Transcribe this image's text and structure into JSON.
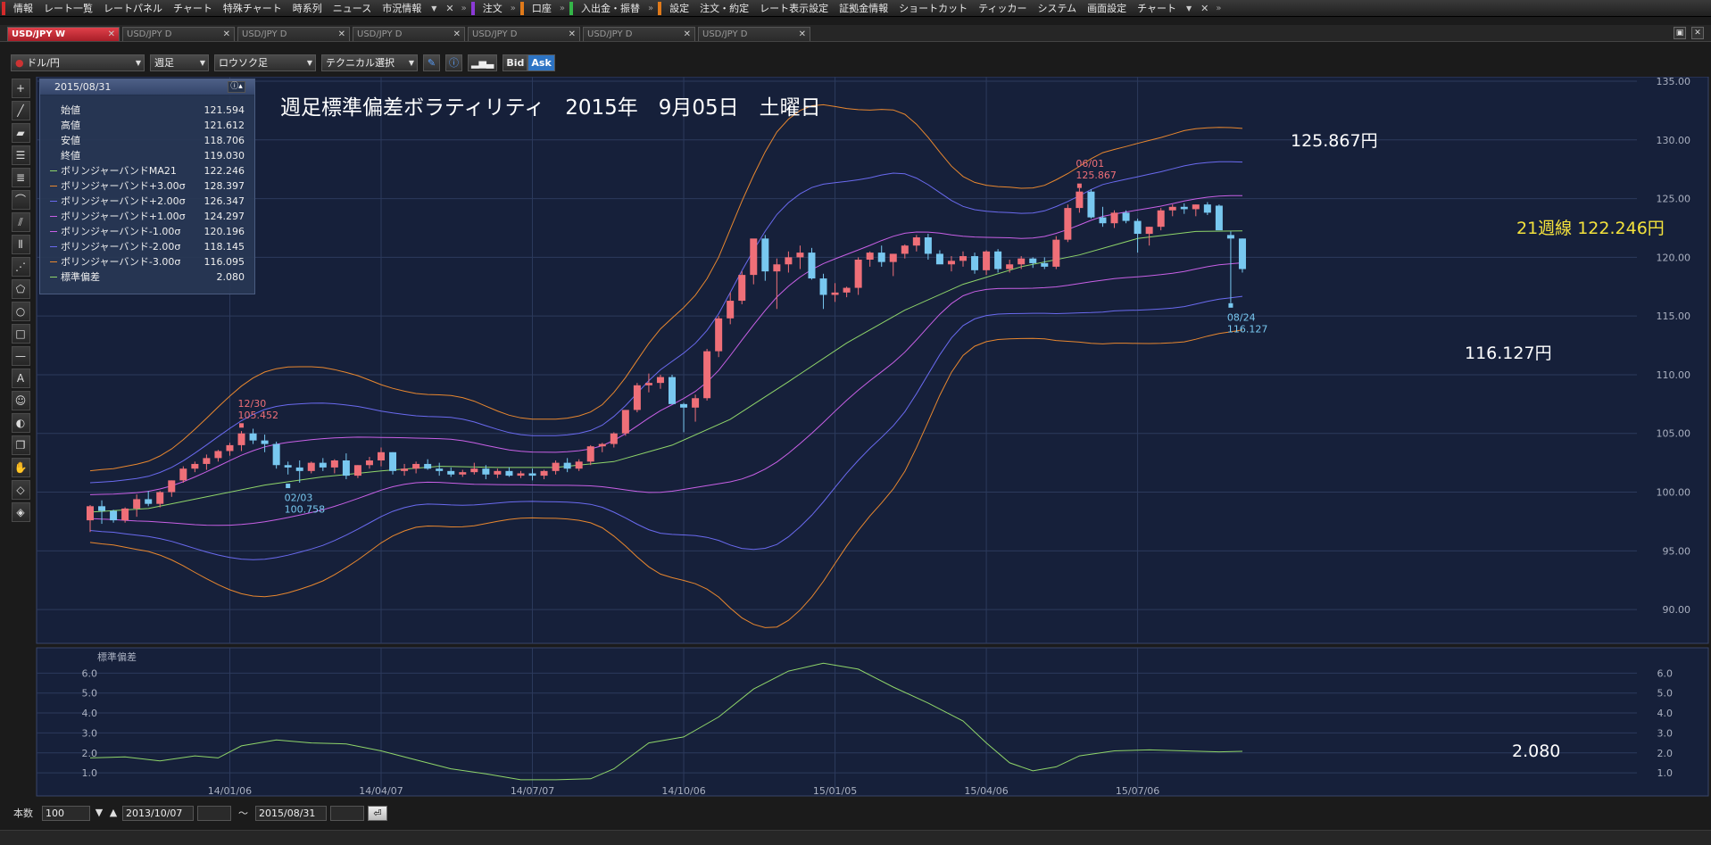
{
  "menu": {
    "groups": [
      {
        "accent": "#d32b2b",
        "items": [
          "情報",
          "レート一覧",
          "レートパネル",
          "チャート",
          "特殊チャート",
          "時系列",
          "ニュース",
          "市況情報"
        ],
        "dropdown": true,
        "close": true
      },
      {
        "accent": "#8b3ad6",
        "items": [
          "注文"
        ],
        "dropdown": false,
        "close": false
      },
      {
        "accent": "#e07a1a",
        "items": [
          "口座"
        ],
        "dropdown": false,
        "close": false
      },
      {
        "accent": "#34b548",
        "items": [
          "入出金・振替"
        ],
        "dropdown": false,
        "close": false
      },
      {
        "accent": "#e07a1a",
        "items": [
          "設定",
          "注文・約定",
          "レート表示設定",
          "証拠金情報",
          "ショートカット",
          "ティッカー",
          "システム",
          "画面設定",
          "チャート"
        ],
        "dropdown": true,
        "close": true
      }
    ]
  },
  "tabs": [
    {
      "label": "USD/JPY W",
      "active": true
    },
    {
      "label": "USD/JPY D",
      "active": false
    },
    {
      "label": "USD/JPY D",
      "active": false
    },
    {
      "label": "USD/JPY D",
      "active": false
    },
    {
      "label": "USD/JPY D",
      "active": false
    },
    {
      "label": "USD/JPY D",
      "active": false
    },
    {
      "label": "USD/JPY D",
      "active": false
    }
  ],
  "toolbar": {
    "pair": "ドル/円",
    "period": "週足",
    "chart_style": "ロウソク足",
    "technical": "テクニカル選択",
    "bid_label": "Bid",
    "ask_label": "Ask"
  },
  "info_panel": {
    "date": "2015/08/31",
    "rows": [
      {
        "label": "始値",
        "value": "121.594",
        "color": ""
      },
      {
        "label": "高値",
        "value": "121.612",
        "color": ""
      },
      {
        "label": "安値",
        "value": "118.706",
        "color": ""
      },
      {
        "label": "終値",
        "value": "119.030",
        "color": ""
      },
      {
        "label": "ボリンジャーバンドMA21",
        "value": "122.246",
        "color": "#8fd56a"
      },
      {
        "label": "ボリンジャーバンド+3.00σ",
        "value": "128.397",
        "color": "#e8872f"
      },
      {
        "label": "ボリンジャーバンド+2.00σ",
        "value": "126.347",
        "color": "#6a6aef"
      },
      {
        "label": "ボリンジャーバンド+1.00σ",
        "value": "124.297",
        "color": "#c860e6"
      },
      {
        "label": "ボリンジャーバンド-1.00σ",
        "value": "120.196",
        "color": "#c860e6"
      },
      {
        "label": "ボリンジャーバンド-2.00σ",
        "value": "118.145",
        "color": "#6a6aef"
      },
      {
        "label": "ボリンジャーバンド-3.00σ",
        "value": "116.095",
        "color": "#e8872f"
      },
      {
        "label": "標準偏差",
        "value": "2.080",
        "color": "#8fd56a"
      }
    ]
  },
  "bottom": {
    "count_label": "本数",
    "count_value": "100",
    "from_date": "2013/10/07",
    "tilde": "〜",
    "to_date": "2015/08/31"
  },
  "chart_data": [
    {
      "type": "candlestick",
      "title": "週足標準偏差ボラティリティ　2015年　9月05日　土曜日",
      "ylim": [
        87.5,
        135
      ],
      "y_ticks": [
        "90.00",
        "95.00",
        "100.00",
        "105.00",
        "110.00",
        "115.00",
        "120.00",
        "125.00",
        "130.00",
        "135.00"
      ],
      "x_ticks": [
        {
          "label": "14/01/06",
          "index": 12
        },
        {
          "label": "14/04/07",
          "index": 25
        },
        {
          "label": "14/07/07",
          "index": 38
        },
        {
          "label": "14/10/06",
          "index": 51
        },
        {
          "label": "15/01/05",
          "index": 64
        },
        {
          "label": "15/04/06",
          "index": 77
        },
        {
          "label": "15/07/06",
          "index": 90
        }
      ],
      "colors": {
        "up": "#ef6f78",
        "down": "#78c8f0",
        "ma21": "#8fd56a",
        "sigma1": "#c860e6",
        "sigma2": "#6a6aef",
        "sigma3": "#e8872f"
      },
      "candles": [
        [
          97.6,
          98.9,
          96.6,
          98.8
        ],
        [
          98.8,
          99.3,
          97.3,
          98.4
        ],
        [
          98.4,
          98.5,
          97.4,
          97.6
        ],
        [
          97.6,
          98.7,
          97.4,
          98.6
        ],
        [
          98.6,
          99.8,
          97.9,
          99.4
        ],
        [
          99.4,
          100.1,
          98.8,
          99.0
        ],
        [
          99.0,
          100.1,
          98.7,
          100.0
        ],
        [
          100.0,
          101.0,
          99.6,
          101.0
        ],
        [
          101.0,
          102.2,
          100.8,
          102.0
        ],
        [
          102.0,
          102.6,
          101.7,
          102.4
        ],
        [
          102.4,
          103.2,
          101.9,
          102.9
        ],
        [
          102.9,
          103.6,
          102.6,
          103.5
        ],
        [
          103.5,
          104.2,
          103.1,
          104.0
        ],
        [
          104.0,
          105.2,
          103.5,
          105.0
        ],
        [
          105.0,
          105.4,
          104.1,
          104.4
        ],
        [
          104.4,
          104.9,
          103.4,
          104.1
        ],
        [
          104.1,
          104.3,
          102.0,
          102.3
        ],
        [
          102.3,
          102.6,
          101.5,
          102.1
        ],
        [
          102.1,
          102.7,
          100.8,
          101.8
        ],
        [
          101.8,
          102.6,
          101.6,
          102.5
        ],
        [
          102.5,
          102.9,
          101.8,
          102.1
        ],
        [
          102.1,
          102.8,
          101.6,
          102.7
        ],
        [
          102.7,
          103.3,
          101.1,
          101.4
        ],
        [
          101.4,
          102.3,
          101.2,
          102.3
        ],
        [
          102.3,
          103.0,
          102.0,
          102.7
        ],
        [
          102.7,
          103.8,
          102.2,
          103.4
        ],
        [
          103.4,
          103.4,
          101.5,
          101.8
        ],
        [
          101.8,
          102.4,
          101.4,
          102.0
        ],
        [
          102.0,
          102.6,
          101.6,
          102.4
        ],
        [
          102.4,
          102.8,
          101.9,
          102.0
        ],
        [
          102.0,
          102.5,
          101.4,
          101.8
        ],
        [
          101.8,
          102.1,
          101.3,
          101.5
        ],
        [
          101.5,
          101.9,
          101.3,
          101.7
        ],
        [
          101.7,
          102.5,
          101.5,
          102.0
        ],
        [
          102.0,
          102.3,
          101.1,
          101.5
        ],
        [
          101.5,
          102.0,
          101.2,
          101.8
        ],
        [
          101.8,
          102.1,
          101.3,
          101.4
        ],
        [
          101.4,
          101.8,
          101.2,
          101.6
        ],
        [
          101.6,
          102.0,
          101.0,
          101.4
        ],
        [
          101.4,
          101.9,
          101.1,
          101.8
        ],
        [
          101.8,
          102.7,
          101.5,
          102.5
        ],
        [
          102.5,
          102.9,
          101.7,
          102.0
        ],
        [
          102.0,
          102.8,
          101.8,
          102.6
        ],
        [
          102.6,
          104.0,
          102.3,
          103.9
        ],
        [
          103.9,
          104.2,
          103.4,
          104.1
        ],
        [
          104.1,
          105.1,
          103.8,
          105.0
        ],
        [
          105.0,
          107.0,
          104.8,
          107.0
        ],
        [
          107.0,
          109.3,
          106.8,
          109.1
        ],
        [
          109.1,
          110.1,
          108.5,
          109.3
        ],
        [
          109.3,
          110.0,
          108.8,
          109.8
        ],
        [
          109.8,
          110.0,
          107.7,
          107.5
        ],
        [
          107.5,
          107.6,
          105.1,
          107.2
        ],
        [
          107.2,
          108.3,
          106.0,
          108.0
        ],
        [
          108.0,
          112.2,
          107.8,
          112.0
        ],
        [
          112.0,
          115.0,
          111.5,
          114.8
        ],
        [
          114.8,
          117.0,
          114.3,
          116.3
        ],
        [
          116.3,
          118.8,
          116.0,
          118.5
        ],
        [
          118.5,
          121.3,
          117.7,
          121.6
        ],
        [
          121.6,
          121.9,
          118.0,
          118.8
        ],
        [
          118.8,
          119.9,
          115.6,
          119.4
        ],
        [
          119.4,
          120.5,
          118.7,
          120.0
        ],
        [
          120.0,
          121.0,
          119.0,
          120.4
        ],
        [
          120.4,
          120.8,
          118.1,
          118.2
        ],
        [
          118.2,
          118.6,
          115.6,
          116.8
        ],
        [
          116.8,
          117.8,
          116.2,
          117.0
        ],
        [
          117.0,
          117.5,
          116.6,
          117.4
        ],
        [
          117.4,
          120.0,
          116.8,
          119.8
        ],
        [
          119.8,
          120.5,
          119.2,
          120.4
        ],
        [
          120.4,
          121.0,
          119.2,
          119.6
        ],
        [
          119.6,
          120.3,
          118.4,
          120.3
        ],
        [
          120.3,
          121.1,
          119.9,
          121.0
        ],
        [
          121.0,
          121.9,
          120.5,
          121.7
        ],
        [
          121.7,
          122.0,
          119.8,
          120.3
        ],
        [
          120.3,
          120.6,
          119.5,
          119.4
        ],
        [
          119.4,
          120.1,
          118.8,
          119.7
        ],
        [
          119.7,
          120.5,
          119.2,
          120.1
        ],
        [
          120.1,
          120.4,
          118.6,
          118.9
        ],
        [
          118.9,
          120.6,
          118.5,
          120.5
        ],
        [
          120.5,
          120.7,
          118.7,
          119.0
        ],
        [
          119.0,
          119.8,
          118.7,
          119.4
        ],
        [
          119.4,
          120.1,
          119.0,
          119.9
        ],
        [
          119.9,
          120.0,
          119.1,
          119.5
        ],
        [
          119.5,
          120.0,
          119.0,
          119.2
        ],
        [
          119.2,
          121.8,
          119.0,
          121.5
        ],
        [
          121.5,
          124.5,
          121.3,
          124.2
        ],
        [
          124.2,
          125.9,
          123.8,
          125.6
        ],
        [
          125.6,
          125.8,
          123.3,
          123.4
        ],
        [
          123.4,
          124.3,
          122.6,
          122.9
        ],
        [
          122.9,
          124.0,
          122.5,
          123.8
        ],
        [
          123.8,
          124.0,
          122.9,
          123.1
        ],
        [
          123.1,
          123.3,
          120.4,
          122.0
        ],
        [
          122.0,
          122.6,
          121.0,
          122.6
        ],
        [
          122.6,
          124.2,
          122.3,
          124.0
        ],
        [
          124.0,
          124.5,
          123.5,
          124.3
        ],
        [
          124.3,
          124.6,
          123.7,
          124.1
        ],
        [
          124.1,
          124.5,
          123.5,
          124.5
        ],
        [
          124.5,
          124.7,
          123.6,
          123.8
        ],
        [
          124.4,
          124.5,
          122.4,
          122.3
        ],
        [
          121.9,
          122.2,
          116.1,
          121.6
        ],
        [
          121.6,
          121.6,
          118.7,
          119.0
        ]
      ],
      "ma21": [
        [
          0,
          98.3
        ],
        [
          5,
          98.6
        ],
        [
          10,
          99.6
        ],
        [
          15,
          100.6
        ],
        [
          20,
          101.3
        ],
        [
          25,
          101.8
        ],
        [
          30,
          102.2
        ],
        [
          35,
          102.1
        ],
        [
          40,
          102.1
        ],
        [
          45,
          102.6
        ],
        [
          50,
          104.0
        ],
        [
          55,
          106.2
        ],
        [
          60,
          109.4
        ],
        [
          65,
          112.7
        ],
        [
          70,
          115.5
        ],
        [
          75,
          117.7
        ],
        [
          80,
          119.2
        ],
        [
          85,
          120.2
        ],
        [
          90,
          121.6
        ],
        [
          95,
          122.2
        ],
        [
          99,
          122.25
        ]
      ],
      "stddev_series": [
        [
          0,
          1.75
        ],
        [
          3,
          1.8
        ],
        [
          6,
          1.6
        ],
        [
          9,
          1.85
        ],
        [
          11,
          1.75
        ],
        [
          13,
          2.35
        ],
        [
          16,
          2.65
        ],
        [
          19,
          2.5
        ],
        [
          22,
          2.45
        ],
        [
          25,
          2.1
        ],
        [
          28,
          1.65
        ],
        [
          31,
          1.2
        ],
        [
          34,
          0.95
        ],
        [
          37,
          0.65
        ],
        [
          40,
          0.65
        ],
        [
          43,
          0.7
        ],
        [
          45,
          1.2
        ],
        [
          48,
          2.5
        ],
        [
          51,
          2.8
        ],
        [
          54,
          3.8
        ],
        [
          57,
          5.2
        ],
        [
          60,
          6.1
        ],
        [
          63,
          6.5
        ],
        [
          66,
          6.2
        ],
        [
          69,
          5.3
        ],
        [
          72,
          4.5
        ],
        [
          75,
          3.6
        ],
        [
          77,
          2.5
        ],
        [
          79,
          1.5
        ],
        [
          81,
          1.1
        ],
        [
          83,
          1.3
        ],
        [
          85,
          1.85
        ],
        [
          88,
          2.1
        ],
        [
          91,
          2.15
        ],
        [
          94,
          2.1
        ],
        [
          97,
          2.05
        ],
        [
          99,
          2.08
        ]
      ],
      "stddev_ylim": [
        0.2,
        7
      ],
      "stddev_ticks": [
        "1.0",
        "2.0",
        "3.0",
        "4.0",
        "5.0",
        "6.0"
      ],
      "stddev_title": "標準偏差",
      "annotations": [
        {
          "index": 13,
          "value": 105.452,
          "date": "12/30",
          "price": "105.452",
          "kind": "high"
        },
        {
          "index": 17,
          "value": 100.758,
          "date": "02/03",
          "price": "100.758",
          "kind": "low"
        },
        {
          "index": 85,
          "value": 125.867,
          "date": "06/01",
          "price": "125.867",
          "kind": "high"
        },
        {
          "index": 98,
          "value": 116.127,
          "date": "08/24",
          "price": "116.127",
          "kind": "low"
        }
      ],
      "big_labels": {
        "high": "125.867円",
        "low": "116.127円",
        "ma": "21週線 122.246円",
        "stddev": "2.080"
      }
    }
  ]
}
